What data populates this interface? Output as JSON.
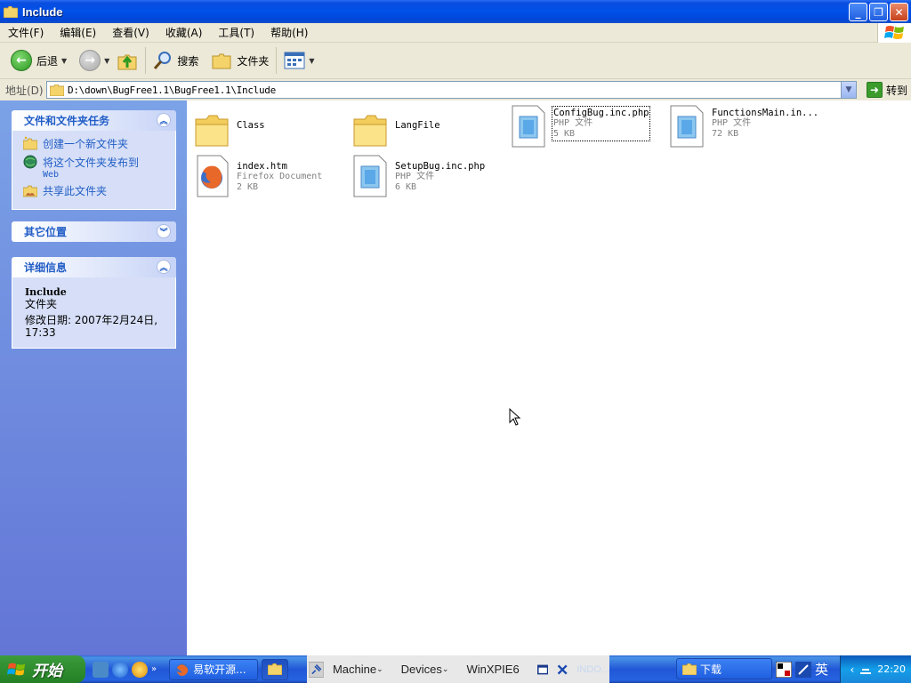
{
  "window": {
    "title": "Include",
    "minimize": "_",
    "maximize": "❐",
    "close": "✕"
  },
  "menu": [
    "文件(F)",
    "编辑(E)",
    "查看(V)",
    "收藏(A)",
    "工具(T)",
    "帮助(H)"
  ],
  "toolbar": {
    "back_label": "后退",
    "search_label": "搜索",
    "folders_label": "文件夹"
  },
  "address": {
    "label": "地址(D)",
    "path": "D:\\down\\BugFree1.1\\BugFree1.1\\Include",
    "goto_label": "转到"
  },
  "taskpane": {
    "tasks": {
      "title": "文件和文件夹任务",
      "items": [
        {
          "label": "创建一个新文件夹",
          "sub": ""
        },
        {
          "label": "将这个文件夹发布到",
          "sub": "Web"
        },
        {
          "label": "共享此文件夹",
          "sub": ""
        }
      ]
    },
    "other": {
      "title": "其它位置"
    },
    "details": {
      "title": "详细信息",
      "name": "Include",
      "type": "文件夹",
      "modified": "修改日期: 2007年2月24日,",
      "time": "17:33"
    }
  },
  "files": [
    {
      "name": "Class",
      "type": "",
      "size": "",
      "kind": "folder"
    },
    {
      "name": "LangFile",
      "type": "",
      "size": "",
      "kind": "folder"
    },
    {
      "name": "ConfigBug.inc.php",
      "type": "PHP 文件",
      "size": "5 KB",
      "kind": "php"
    },
    {
      "name": "FunctionsMain.in...",
      "type": "PHP 文件",
      "size": "72 KB",
      "kind": "php"
    },
    {
      "name": "index.htm",
      "type": "Firefox Document",
      "size": "2 KB",
      "kind": "firefox"
    },
    {
      "name": "SetupBug.inc.php",
      "type": "PHP 文件",
      "size": "6 KB",
      "kind": "php"
    }
  ],
  "taskbar": {
    "start_label": "开始",
    "buttons": [
      "易软开源...",
      "INDO...",
      "下载"
    ],
    "vm_menu": [
      "Machine",
      "Devices",
      "WinXPIE6"
    ],
    "ime": "英",
    "clock": "22:20"
  }
}
